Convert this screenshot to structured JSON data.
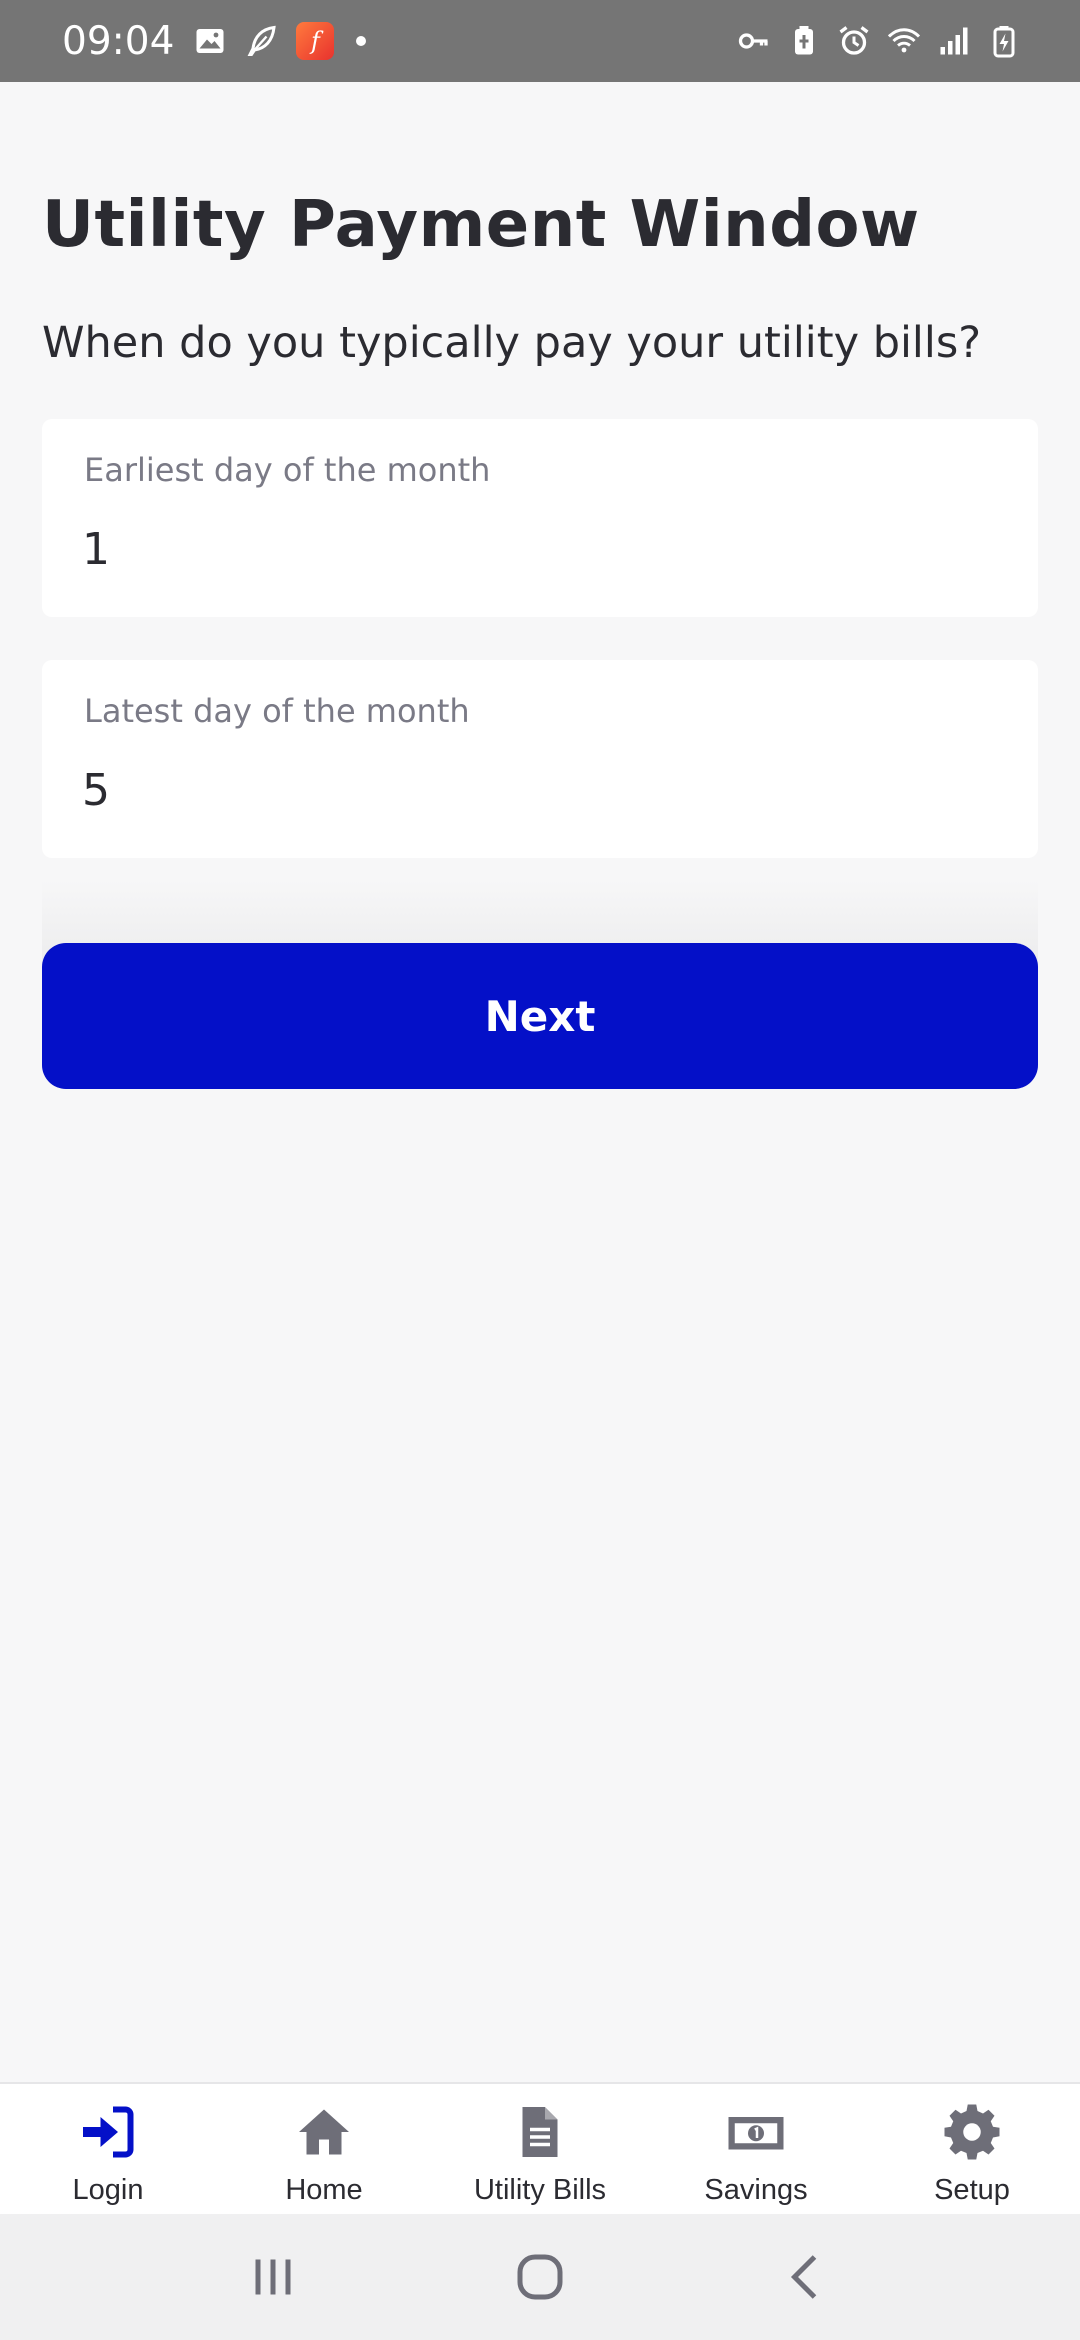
{
  "status_bar": {
    "time": "09:04",
    "left_icons": [
      "image-icon",
      "feather-icon",
      "app-f-icon",
      "dot-icon"
    ],
    "right_icons": [
      "key-icon",
      "battery-saver-icon",
      "alarm-icon",
      "wifi-icon",
      "signal-icon",
      "battery-charging-icon"
    ]
  },
  "page": {
    "title": "Utility Payment Window",
    "question": "When do you typically pay your utility bills?"
  },
  "form": {
    "earliest": {
      "label": "Earliest day of the month",
      "value": "1"
    },
    "latest": {
      "label": "Latest day of the month",
      "value": "5"
    },
    "next_label": "Next"
  },
  "bottom_nav": {
    "items": [
      {
        "label": "Login",
        "icon": "login-icon",
        "active": true
      },
      {
        "label": "Home",
        "icon": "home-icon",
        "active": false
      },
      {
        "label": "Utility Bills",
        "icon": "document-icon",
        "active": false
      },
      {
        "label": "Savings",
        "icon": "money-icon",
        "active": false
      },
      {
        "label": "Setup",
        "icon": "gear-icon",
        "active": false
      }
    ]
  },
  "colors": {
    "accent": "#0410c8",
    "nav_inactive": "#6e6e78",
    "text": "#2b2b31",
    "label": "#7a7a86"
  }
}
